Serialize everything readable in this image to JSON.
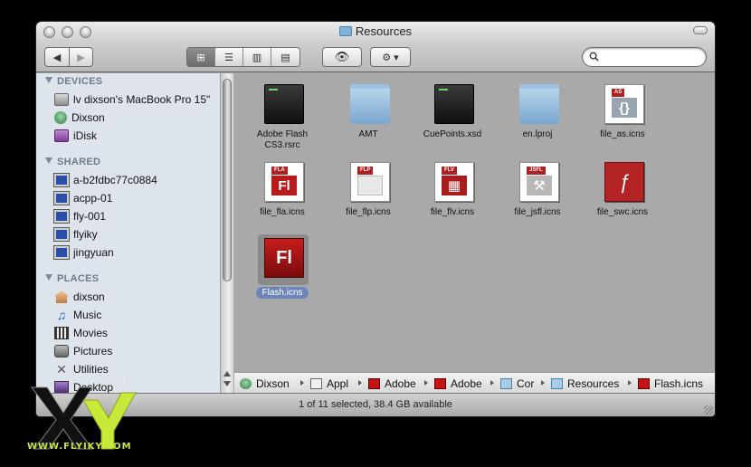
{
  "window": {
    "title": "Resources"
  },
  "toolbar": {
    "back_label": "◀",
    "forward_label": "▶",
    "view_icons": "⊞",
    "view_list": "☰",
    "view_columns": "▥",
    "view_coverflow": "▤",
    "quicklook_label": "👁",
    "action_label": "⚙ ▾",
    "search_placeholder": "",
    "search_value": ""
  },
  "sidebar": {
    "devices_header": "DEVICES",
    "shared_header": "SHARED",
    "places_header": "PLACES",
    "devices": [
      {
        "label": "lv dixson's MacBook Pro 15\"",
        "icon": "hard-drive-icon"
      },
      {
        "label": "Dixson",
        "icon": "globe-icon"
      },
      {
        "label": "iDisk",
        "icon": "idisk-icon"
      }
    ],
    "shared": [
      {
        "label": "a-b2fdbc77c0884",
        "icon": "monitor-icon"
      },
      {
        "label": "acpp-01",
        "icon": "monitor-icon"
      },
      {
        "label": "fly-001",
        "icon": "monitor-icon"
      },
      {
        "label": "flyiky",
        "icon": "monitor-icon"
      },
      {
        "label": "jingyuan",
        "icon": "monitor-icon"
      }
    ],
    "places": [
      {
        "label": "dixson",
        "icon": "home-icon"
      },
      {
        "label": "Music",
        "icon": "music-icon"
      },
      {
        "label": "Movies",
        "icon": "movie-icon"
      },
      {
        "label": "Pictures",
        "icon": "camera-icon"
      },
      {
        "label": "Utilities",
        "icon": "tools-icon"
      },
      {
        "label": "Desktop",
        "icon": "desktop-icon"
      }
    ]
  },
  "files": [
    {
      "name": "Adobe Flash\nCS3.rsrc",
      "line1": "Adobe Flash",
      "line2": "CS3.rsrc",
      "kind": "terminal"
    },
    {
      "name": "AMT",
      "line1": "AMT",
      "line2": "",
      "kind": "folder"
    },
    {
      "name": "CuePoints.xsd",
      "line1": "CuePoints.xsd",
      "line2": "",
      "kind": "terminal"
    },
    {
      "name": "en.lproj",
      "line1": "en.lproj",
      "line2": "",
      "kind": "folder"
    },
    {
      "name": "file_as.icns",
      "line1": "file_as.icns",
      "line2": "",
      "kind": "doc",
      "tag": "AS",
      "core": "{}",
      "tag_color": "#b02020",
      "core_color": "#9aa4b0"
    },
    {
      "name": "file_fla.icns",
      "line1": "file_fla.icns",
      "line2": "",
      "kind": "doc",
      "tag": "FLA",
      "core": "Fl",
      "tag_color": "#b02020",
      "core_color": "#b71a1a"
    },
    {
      "name": "file_flp.icns",
      "line1": "file_flp.icns",
      "line2": "",
      "kind": "doc",
      "tag": "FLP",
      "core": "",
      "tag_color": "#b02020",
      "core_color": "#e8e8e8"
    },
    {
      "name": "file_flv.icns",
      "line1": "file_flv.icns",
      "line2": "",
      "kind": "doc",
      "tag": "FLV",
      "core": "▦",
      "tag_color": "#b02020",
      "core_color": "#a81c1c"
    },
    {
      "name": "file_jsfl.icns",
      "line1": "file_jsfl.icns",
      "line2": "",
      "kind": "doc",
      "tag": "JSFL",
      "core": "⚒",
      "tag_color": "#b02020",
      "core_color": "#b8b8b8"
    },
    {
      "name": "file_swc.icns",
      "line1": "file_swc.icns",
      "line2": "",
      "kind": "swc",
      "core": "ƒ"
    },
    {
      "name": "Flash.icns",
      "line1": "Flash.icns",
      "line2": "",
      "kind": "app",
      "core": "Fl",
      "selected": true
    }
  ],
  "pathbar": [
    {
      "label": "Dixson",
      "icon": "globe-icon"
    },
    {
      "label": "Appl",
      "icon": "applications-folder-icon"
    },
    {
      "label": "Adobe",
      "icon": "flash-icon"
    },
    {
      "label": "Adobe",
      "icon": "flash-icon"
    },
    {
      "label": "Cor",
      "icon": "folder-icon"
    },
    {
      "label": "Resources",
      "icon": "folder-icon"
    },
    {
      "label": "Flash.icns",
      "icon": "flash-icon"
    }
  ],
  "status": {
    "text": "1 of 11 selected, 38.4 GB available"
  },
  "watermark": {
    "text": "WWW.FLYIKY.COM",
    "registered": "®"
  },
  "colors": {
    "selection": "#6d86b8",
    "sidebar_bg": "#dde4ec",
    "content_bg": "#a9a9a9",
    "flash_red": "#b71a1a"
  }
}
